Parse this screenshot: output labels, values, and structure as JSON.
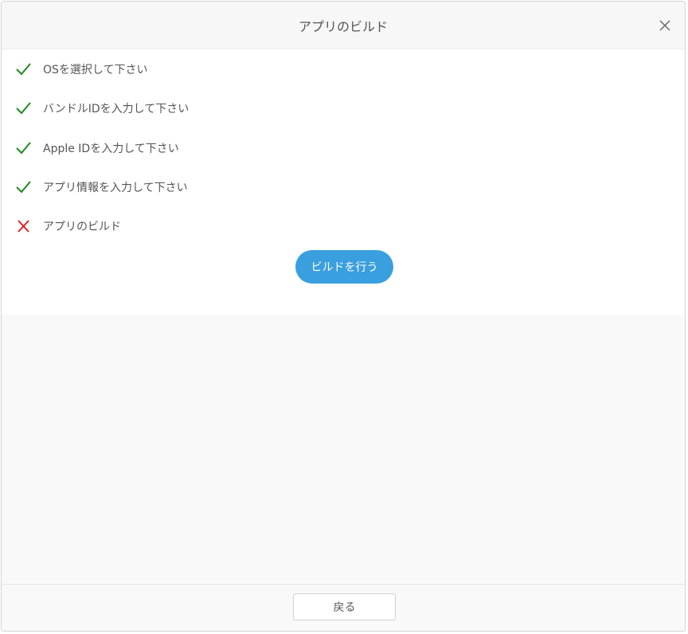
{
  "dialog": {
    "title": "アプリのビルド",
    "close_icon": "close-icon"
  },
  "steps": [
    {
      "label": "OSを選択して下さい",
      "status": "done",
      "icon": "check-icon"
    },
    {
      "label": "バンドルIDを入力して下さい",
      "status": "done",
      "icon": "check-icon"
    },
    {
      "label": "Apple IDを入力して下さい",
      "status": "done",
      "icon": "check-icon"
    },
    {
      "label": "アプリ情報を入力して下さい",
      "status": "done",
      "icon": "check-icon"
    },
    {
      "label": "アプリのビルド",
      "status": "incomplete",
      "icon": "cross-icon"
    }
  ],
  "actions": {
    "build_label": "ビルドを行う",
    "back_label": "戻る"
  },
  "colors": {
    "check": "#1e8a1e",
    "cross": "#e02020",
    "primary": "#3a9fde"
  }
}
